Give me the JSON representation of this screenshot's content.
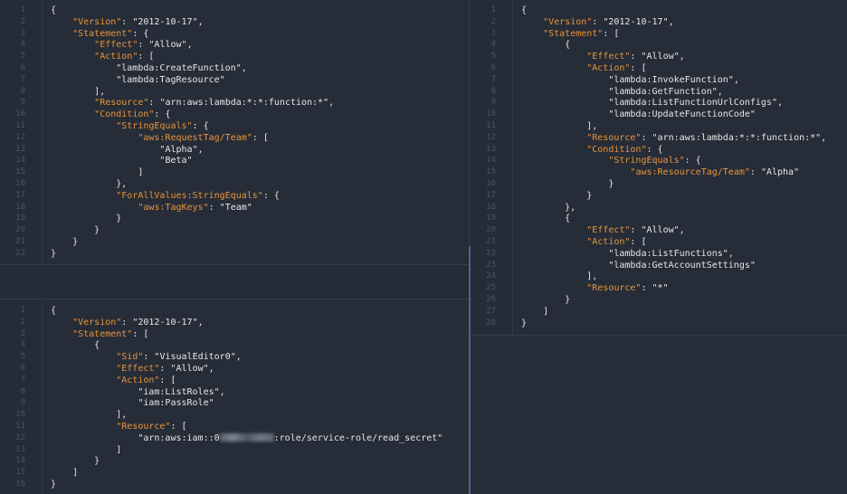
{
  "colors": {
    "background": "#262d38",
    "key": "#e8943a",
    "string": "#e6e6e6",
    "line_number": "#4b5465",
    "active_divider": "#4a6390"
  },
  "panes": {
    "a": {
      "lines": [
        {
          "n": "1",
          "code": "{"
        },
        {
          "n": "2",
          "code": "    \"Version\": \"2012-10-17\","
        },
        {
          "n": "3",
          "code": "    \"Statement\": {"
        },
        {
          "n": "4",
          "code": "        \"Effect\": \"Allow\","
        },
        {
          "n": "5",
          "code": "        \"Action\": ["
        },
        {
          "n": "6",
          "code": "            \"lambda:CreateFunction\","
        },
        {
          "n": "7",
          "code": "            \"lambda:TagResource\""
        },
        {
          "n": "8",
          "code": "        ],"
        },
        {
          "n": "9",
          "code": "        \"Resource\": \"arn:aws:lambda:*:*:function:*\","
        },
        {
          "n": "10",
          "code": "        \"Condition\": {"
        },
        {
          "n": "11",
          "code": "            \"StringEquals\": {"
        },
        {
          "n": "12",
          "code": "                \"aws:RequestTag/Team\": ["
        },
        {
          "n": "13",
          "code": "                    \"Alpha\","
        },
        {
          "n": "14",
          "code": "                    \"Beta\""
        },
        {
          "n": "15",
          "code": "                ]"
        },
        {
          "n": "16",
          "code": "            },"
        },
        {
          "n": "17",
          "code": "            \"ForAllValues:StringEquals\": {"
        },
        {
          "n": "18",
          "code": "                \"aws:TagKeys\": \"Team\""
        },
        {
          "n": "19",
          "code": "            }"
        },
        {
          "n": "20",
          "code": "        }"
        },
        {
          "n": "21",
          "code": "    }"
        },
        {
          "n": "22",
          "code": "}"
        }
      ]
    },
    "b": {
      "lines": [
        {
          "n": "1",
          "code": "{"
        },
        {
          "n": "2",
          "code": "    \"Version\": \"2012-10-17\","
        },
        {
          "n": "3",
          "code": "    \"Statement\": ["
        },
        {
          "n": "4",
          "code": "        {"
        },
        {
          "n": "5",
          "code": "            \"Sid\": \"VisualEditor0\","
        },
        {
          "n": "6",
          "code": "            \"Effect\": \"Allow\","
        },
        {
          "n": "7",
          "code": "            \"Action\": ["
        },
        {
          "n": "8",
          "code": "                \"iam:ListRoles\","
        },
        {
          "n": "9",
          "code": "                \"iam:PassRole\""
        },
        {
          "n": "10",
          "code": "            ],"
        },
        {
          "n": "11",
          "code": "            \"Resource\": ["
        },
        {
          "n": "12",
          "code": "                \"arn:aws:iam::0",
          "redacted": true,
          "after": ":role/service-role/read_secret\""
        },
        {
          "n": "13",
          "code": "            ]"
        },
        {
          "n": "14",
          "code": "        }"
        },
        {
          "n": "15",
          "code": "    ]"
        },
        {
          "n": "16",
          "code": "}"
        }
      ]
    },
    "c": {
      "lines": [
        {
          "n": "1",
          "code": "{"
        },
        {
          "n": "2",
          "code": "    \"Version\": \"2012-10-17\","
        },
        {
          "n": "3",
          "code": "    \"Statement\": ["
        },
        {
          "n": "4",
          "code": "        {"
        },
        {
          "n": "5",
          "code": "            \"Effect\": \"Allow\","
        },
        {
          "n": "6",
          "code": "            \"Action\": ["
        },
        {
          "n": "7",
          "code": "                \"lambda:InvokeFunction\","
        },
        {
          "n": "8",
          "code": "                \"lambda:GetFunction\","
        },
        {
          "n": "9",
          "code": "                \"lambda:ListFunctionUrlConfigs\","
        },
        {
          "n": "10",
          "code": "                \"lambda:UpdateFunctionCode\""
        },
        {
          "n": "11",
          "code": "            ],"
        },
        {
          "n": "12",
          "code": "            \"Resource\": \"arn:aws:lambda:*:*:function:*\","
        },
        {
          "n": "13",
          "code": "            \"Condition\": {"
        },
        {
          "n": "14",
          "code": "                \"StringEquals\": {"
        },
        {
          "n": "15",
          "code": "                    \"aws:ResourceTag/Team\": \"Alpha\""
        },
        {
          "n": "16",
          "code": "                }"
        },
        {
          "n": "17",
          "code": "            }"
        },
        {
          "n": "18",
          "code": "        },"
        },
        {
          "n": "19",
          "code": "        {"
        },
        {
          "n": "20",
          "code": "            \"Effect\": \"Allow\","
        },
        {
          "n": "21",
          "code": "            \"Action\": ["
        },
        {
          "n": "22",
          "code": "                \"lambda:ListFunctions\","
        },
        {
          "n": "23",
          "code": "                \"lambda:GetAccountSettings\""
        },
        {
          "n": "24",
          "code": "            ],"
        },
        {
          "n": "25",
          "code": "            \"Resource\": \"*\""
        },
        {
          "n": "26",
          "code": "        }"
        },
        {
          "n": "27",
          "code": "    ]"
        },
        {
          "n": "28",
          "code": "}"
        }
      ]
    }
  }
}
